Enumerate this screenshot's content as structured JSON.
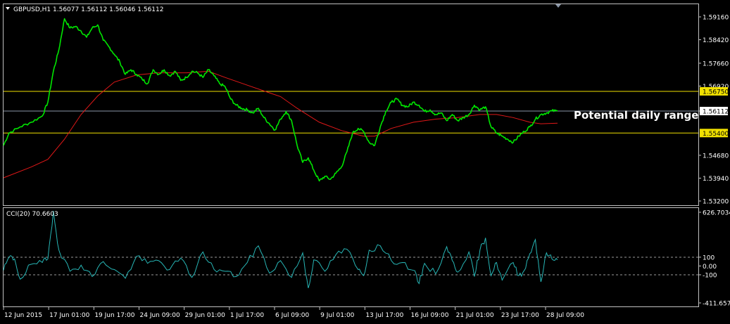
{
  "header": {
    "symbol_info": "GBPUSD,H1  1.56077  1.56112  1.56046  1.56112"
  },
  "annotation": {
    "text": "Potential daily range"
  },
  "indicator": {
    "label": "CCI(20) 70.6603"
  },
  "colors": {
    "background": "#000000",
    "frame": "#c0c0c0",
    "price_line": "#00e600",
    "moving_average": "#e01818",
    "range_lines": "#f0e000",
    "current_price_line": "#8a96a8",
    "cci_line": "#27b6b6",
    "level_lines": "#9a9a9a",
    "axis_text": "#ffffff",
    "range_tag_fill": "#f0e000",
    "range_tag_text": "#000000"
  },
  "chart_data": [
    {
      "type": "line",
      "name": "GBPUSD H1 price",
      "ylim": [
        1.532,
        1.5916
      ],
      "y_ticks": [
        "1.59160",
        "1.58420",
        "1.57660",
        "1.56920",
        "1.56112",
        "1.54680",
        "1.53940",
        "1.53200"
      ],
      "x_ticks": [
        "12 Jun 2015",
        "17 Jun 01:00",
        "19 Jun 17:00",
        "24 Jun 09:00",
        "29 Jun 01:00",
        "1 Jul 17:00",
        "6 Jul 09:00",
        "9 Jul 01:00",
        "13 Jul 17:00",
        "16 Jul 09:00",
        "21 Jul 01:00",
        "23 Jul 17:00",
        "28 Jul 09:00"
      ],
      "x_span": [
        0,
        100
      ],
      "price_path": [
        [
          0,
          1.55
        ],
        [
          1,
          1.554
        ],
        [
          3,
          1.556
        ],
        [
          5,
          1.5575
        ],
        [
          7,
          1.5595
        ],
        [
          8,
          1.564
        ],
        [
          9,
          1.574
        ],
        [
          10,
          1.581
        ],
        [
          11,
          1.591
        ],
        [
          12,
          1.588
        ],
        [
          13,
          1.5885
        ],
        [
          14,
          1.587
        ],
        [
          15,
          1.585
        ],
        [
          16,
          1.588
        ],
        [
          17,
          1.589
        ],
        [
          18,
          1.584
        ],
        [
          19,
          1.582
        ],
        [
          20,
          1.5795
        ],
        [
          21,
          1.577
        ],
        [
          22,
          1.573
        ],
        [
          23,
          1.5745
        ],
        [
          24,
          1.573
        ],
        [
          25,
          1.5715
        ],
        [
          26,
          1.57
        ],
        [
          27,
          1.5745
        ],
        [
          28,
          1.573
        ],
        [
          29,
          1.5745
        ],
        [
          30,
          1.5725
        ],
        [
          31,
          1.574
        ],
        [
          32,
          1.571
        ],
        [
          33,
          1.572
        ],
        [
          34,
          1.574
        ],
        [
          35,
          1.5735
        ],
        [
          36,
          1.572
        ],
        [
          37,
          1.5745
        ],
        [
          38,
          1.5725
        ],
        [
          39,
          1.57
        ],
        [
          40,
          1.569
        ],
        [
          41,
          1.565
        ],
        [
          42,
          1.563
        ],
        [
          43,
          1.562
        ],
        [
          44,
          1.5615
        ],
        [
          45,
          1.5605
        ],
        [
          46,
          1.562
        ],
        [
          47,
          1.559
        ],
        [
          48,
          1.557
        ],
        [
          49,
          1.555
        ],
        [
          50,
          1.5585
        ],
        [
          51,
          1.561
        ],
        [
          52,
          1.558
        ],
        [
          53,
          1.55
        ],
        [
          54,
          1.5445
        ],
        [
          55,
          1.546
        ],
        [
          56,
          1.542
        ],
        [
          57,
          1.5385
        ],
        [
          58,
          1.54
        ],
        [
          59,
          1.539
        ],
        [
          60,
          1.541
        ],
        [
          61,
          1.543
        ],
        [
          62,
          1.548
        ],
        [
          63,
          1.554
        ],
        [
          64,
          1.5555
        ],
        [
          65,
          1.5545
        ],
        [
          66,
          1.551
        ],
        [
          67,
          1.55
        ],
        [
          68,
          1.556
        ],
        [
          69,
          1.561
        ],
        [
          70,
          1.564
        ],
        [
          71,
          1.565
        ],
        [
          72,
          1.563
        ],
        [
          73,
          1.5625
        ],
        [
          74,
          1.564
        ],
        [
          75,
          1.563
        ],
        [
          76,
          1.561
        ],
        [
          77,
          1.5615
        ],
        [
          78,
          1.56
        ],
        [
          79,
          1.5605
        ],
        [
          80,
          1.558
        ],
        [
          81,
          1.56
        ],
        [
          82,
          1.558
        ],
        [
          83,
          1.559
        ],
        [
          84,
          1.56
        ],
        [
          85,
          1.563
        ],
        [
          86,
          1.5615
        ],
        [
          87,
          1.5625
        ],
        [
          88,
          1.556
        ],
        [
          89,
          1.554
        ],
        [
          90,
          1.553
        ],
        [
          91,
          1.552
        ],
        [
          92,
          1.551
        ],
        [
          93,
          1.553
        ],
        [
          94,
          1.5545
        ],
        [
          95,
          1.556
        ],
        [
          96,
          1.5585
        ],
        [
          97,
          1.56
        ],
        [
          98,
          1.5605
        ],
        [
          99,
          1.5612
        ],
        [
          100,
          1.5611
        ]
      ],
      "moving_average_path": [
        [
          0,
          1.5395
        ],
        [
          5,
          1.543
        ],
        [
          8,
          1.5455
        ],
        [
          11,
          1.552
        ],
        [
          14,
          1.56
        ],
        [
          17,
          1.566
        ],
        [
          20,
          1.5705
        ],
        [
          24,
          1.5728
        ],
        [
          28,
          1.5735
        ],
        [
          33,
          1.5735
        ],
        [
          37,
          1.574
        ],
        [
          40,
          1.572
        ],
        [
          44,
          1.5695
        ],
        [
          48,
          1.567
        ],
        [
          50,
          1.5658
        ],
        [
          53,
          1.562
        ],
        [
          57,
          1.5575
        ],
        [
          61,
          1.5548
        ],
        [
          65,
          1.553
        ],
        [
          67,
          1.553
        ],
        [
          70,
          1.5555
        ],
        [
          74,
          1.5575
        ],
        [
          78,
          1.5585
        ],
        [
          82,
          1.559
        ],
        [
          86,
          1.56
        ],
        [
          89,
          1.56
        ],
        [
          92,
          1.559
        ],
        [
          95,
          1.5575
        ],
        [
          97,
          1.557
        ],
        [
          100,
          1.5572
        ]
      ],
      "levels": {
        "range_high": 1.5675,
        "current": 1.56112,
        "range_low": 1.554
      },
      "range_tags": [
        "1.56750",
        "1.55400"
      ],
      "current_tag": "1.56112"
    },
    {
      "type": "line",
      "name": "CCI(20)",
      "ylim": [
        -411.6578,
        626.7034
      ],
      "y_ticks": [
        "626.7034",
        "100",
        "0.00",
        "-100",
        "-411.6578"
      ],
      "levels": [
        100,
        -100
      ],
      "last_value": 70.6603,
      "cci_path": [
        [
          0,
          -50
        ],
        [
          1,
          100
        ],
        [
          2,
          80
        ],
        [
          3,
          -150
        ],
        [
          5,
          20
        ],
        [
          7,
          40
        ],
        [
          8,
          80
        ],
        [
          9,
          626
        ],
        [
          10,
          180
        ],
        [
          12,
          -60
        ],
        [
          14,
          10
        ],
        [
          16,
          -120
        ],
        [
          18,
          50
        ],
        [
          20,
          -40
        ],
        [
          22,
          -140
        ],
        [
          24,
          110
        ],
        [
          26,
          30
        ],
        [
          28,
          60
        ],
        [
          30,
          -40
        ],
        [
          32,
          90
        ],
        [
          34,
          -130
        ],
        [
          36,
          160
        ],
        [
          38,
          -40
        ],
        [
          40,
          -60
        ],
        [
          42,
          -120
        ],
        [
          44,
          40
        ],
        [
          46,
          230
        ],
        [
          48,
          -80
        ],
        [
          50,
          60
        ],
        [
          52,
          -130
        ],
        [
          54,
          150
        ],
        [
          55,
          -250
        ],
        [
          56,
          70
        ],
        [
          58,
          -60
        ],
        [
          60,
          130
        ],
        [
          62,
          190
        ],
        [
          64,
          -40
        ],
        [
          65,
          -110
        ],
        [
          66,
          180
        ],
        [
          68,
          230
        ],
        [
          70,
          60
        ],
        [
          72,
          40
        ],
        [
          74,
          -50
        ],
        [
          75,
          -200
        ],
        [
          76,
          30
        ],
        [
          78,
          -90
        ],
        [
          80,
          220
        ],
        [
          81,
          60
        ],
        [
          82,
          -70
        ],
        [
          84,
          160
        ],
        [
          85,
          -120
        ],
        [
          86,
          180
        ],
        [
          87,
          320
        ],
        [
          88,
          -110
        ],
        [
          89,
          40
        ],
        [
          90,
          -160
        ],
        [
          92,
          40
        ],
        [
          93,
          -110
        ],
        [
          94,
          -50
        ],
        [
          95,
          140
        ],
        [
          96,
          300
        ],
        [
          97,
          -180
        ],
        [
          98,
          150
        ],
        [
          99,
          80
        ],
        [
          100,
          71
        ]
      ]
    }
  ]
}
